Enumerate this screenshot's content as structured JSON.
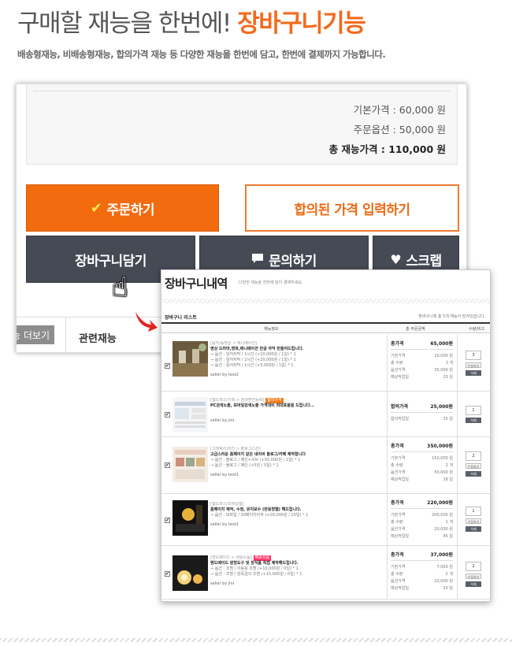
{
  "headline": {
    "plain": "구매할 재능을 한번에!",
    "accent": "장바구니기능"
  },
  "subtitle": "배송형재능, 비배송형재능, 합의가격 재능 등 다양한 재능을 한번에 담고, 한번에 결제까지 가능합니다.",
  "price_box": {
    "base": "기본가격 : 60,000 원",
    "option": "주문옵션 : 50,000 원",
    "total": "총 재능가격 : 110,000 원"
  },
  "buttons": {
    "order": "주문하기",
    "agreed_price": "합의된 가격 입력하기",
    "cart": "장바구니담기",
    "inquiry": "문의하기",
    "scrap": "스크랩"
  },
  "tabs": {
    "more": "능 더보기",
    "related": "관련재능"
  },
  "accent_color": "#f26b0f",
  "icons": [
    "check-icon",
    "speech-bubble-icon",
    "heart-icon",
    "hand-pointer-icon",
    "red-arrow-icon"
  ],
  "cart_popup": {
    "title": "장바구니내역",
    "desc": "다양한 재능을 한번에 담아 결제하세요.",
    "list_title": "장바구니 리스트",
    "count_note": "장바구니에 총 5개 재능이 담겨있습니다.",
    "col_info": "재능정보",
    "col_price": "총 주문금액",
    "col_qty": "수량/비고",
    "items": [
      {
        "category": "[음악/동영상 > 애니메이션]",
        "name": "영상 드라마,영화,애니메이션 한글 자막 만들어드립니다.",
        "badge": "",
        "options": [
          "→ 옵션 : 일어자막 / 1시간 (+10,000원 / 1일) * 1",
          "→ 옵션 : 일어자막 / 2시간 (+20,000원 / 1일) * 1",
          "→ 옵션 : 중어자막 / 1시간 (+5,000원 / 1일) * 1"
        ],
        "seller": "seller by test2",
        "total_label": "총가격",
        "total": "65,000원",
        "rows": [
          [
            "기본가격",
            "10,000 원"
          ],
          [
            "총 수량",
            "3 개"
          ],
          [
            "옵션가격",
            "35,000 원"
          ],
          [
            "예상작업일",
            "23 일"
          ]
        ],
        "qty": "3",
        "edit": "수정하기",
        "del": "삭제"
      },
      {
        "category": "[웹오피스/기획 > 검색엔진등록]",
        "name": "PC검색노출, 모바일검색노출 가격대비 최대효율을 드립니다...",
        "badge": "합의가격",
        "options": [],
        "seller": "seller by jini",
        "total_label": "합의가격",
        "total": "25,000원",
        "rows": [
          [
            "합의작업일",
            "10 일"
          ]
        ],
        "qty": "1",
        "edit": "",
        "del": "삭제"
      },
      {
        "category": "[그래픽/디자인 > 블로그스킨]",
        "name": "고급스러운 홈페이지 같은 네이버 블로그/카페 제작합니다",
        "badge": "",
        "options": [
          "→ 옵션 : 블로그 / 메인+서브 (+50,000원 / 1일) * 1",
          "→ 옵션 : 블로그 / 메인 (+5원 / 5일) * 1"
        ],
        "seller": "seller by test3",
        "total_label": "총가격",
        "total": "350,000원",
        "rows": [
          [
            "기본가격",
            "150,000 원"
          ],
          [
            "총 수량",
            "2 개"
          ],
          [
            "옵션가격",
            "50,000 원"
          ],
          [
            "예상작업일",
            "16 일"
          ]
        ],
        "qty": "2",
        "edit": "수정하기",
        "del": "삭제"
      },
      {
        "category": "[웹오피스/모바일웹]",
        "name": "홈페이지 제작, 수정, 유지보수 (반응형웹) 해드립니다.",
        "badge": "",
        "options": [
          "→ 옵션 : 모바일 / 20페이지이하 (+20,000원 / 20일) * 1"
        ],
        "seller": "seller by test2",
        "total_label": "총가격",
        "total": "220,000원",
        "rows": [
          [
            "기본가격",
            "200,000 원"
          ],
          [
            "총 수량",
            "1 개"
          ],
          [
            "옵션가격",
            "20,000 원"
          ],
          [
            "예상작업일",
            "45 일"
          ]
        ],
        "qty": "1",
        "edit": "수정하기",
        "del": "삭제"
      },
      {
        "category": "[핸드메이드 > 생활소품]",
        "name": "핸드메이드 원형도구 및 장식품 직접 제작해드립니다.",
        "badge": "배송상품",
        "options": [
          "→ 옵션 : 조명 / 아동용 조명 (+10,000원 / 0일) * 1",
          "→ 옵션 : 조명 / 원목걸이 조명 (+15,000원 / 0일) * 1"
        ],
        "seller": "seller by jini",
        "total_label": "총가격",
        "total": "37,000원",
        "rows": [
          [
            "기본가격",
            "7,000 원"
          ],
          [
            "총 수량",
            "2 개"
          ],
          [
            "옵션가격",
            "23,000 원"
          ],
          [
            "예상작업일",
            "20 일"
          ]
        ],
        "qty": "2",
        "edit": "수정하기",
        "del": "삭제"
      }
    ]
  }
}
